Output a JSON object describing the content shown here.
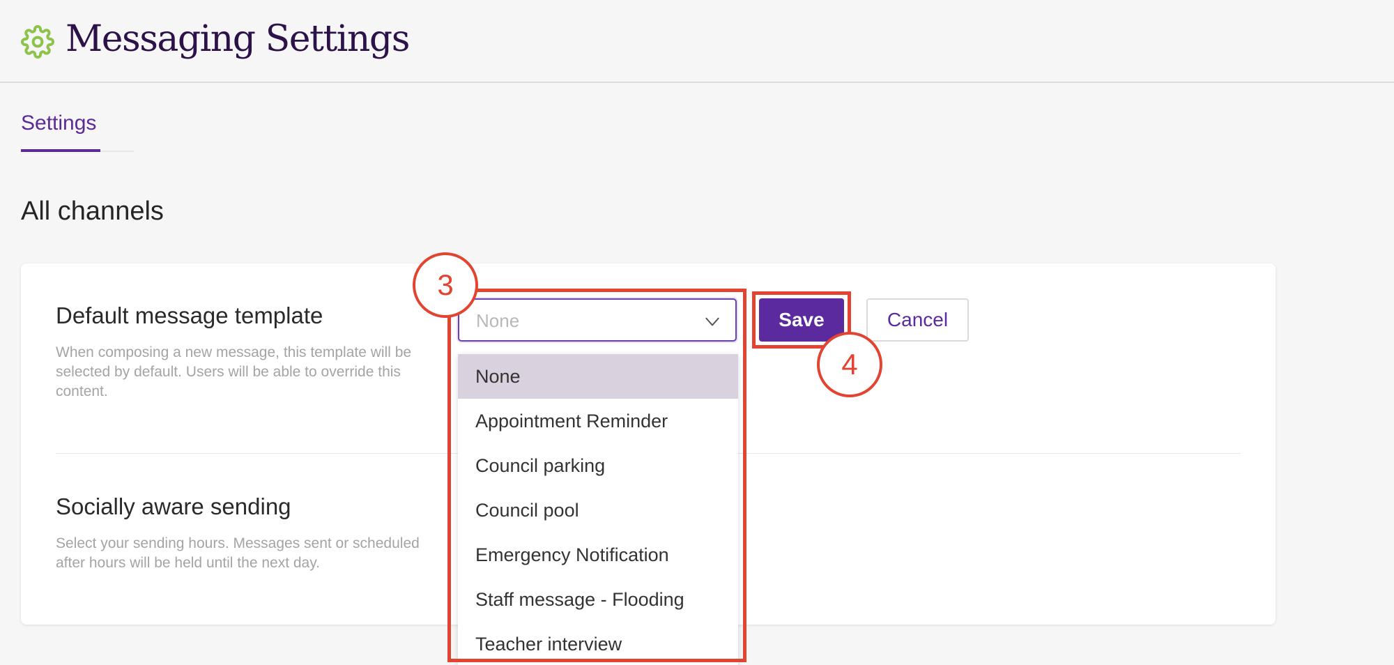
{
  "header": {
    "title": "Messaging Settings",
    "icon": "gear-icon",
    "icon_color": "#8dc24b"
  },
  "tabs": [
    {
      "label": "Settings",
      "active": true
    }
  ],
  "section_title": "All channels",
  "settings": [
    {
      "title": "Default message template",
      "description": "When composing a new message, this template will be selected by default. Users will be able to override this content."
    },
    {
      "title": "Socially aware sending",
      "description": "Select your sending hours. Messages sent or scheduled after hours will be held until the next day."
    }
  ],
  "template_select": {
    "value": "None",
    "options": [
      "None",
      "Appointment Reminder",
      "Council parking",
      "Council pool",
      "Emergency Notification",
      "Staff message - Flooding",
      "Teacher interview"
    ],
    "selected_index": 0
  },
  "buttons": {
    "save_label": "Save",
    "cancel_label": "Cancel"
  },
  "annotations": [
    {
      "label": "3"
    },
    {
      "label": "4"
    }
  ],
  "colors": {
    "accent": "#5a2a9e",
    "title": "#2b1248",
    "annotation": "#e34432",
    "selected_option": "#d9d1de"
  }
}
